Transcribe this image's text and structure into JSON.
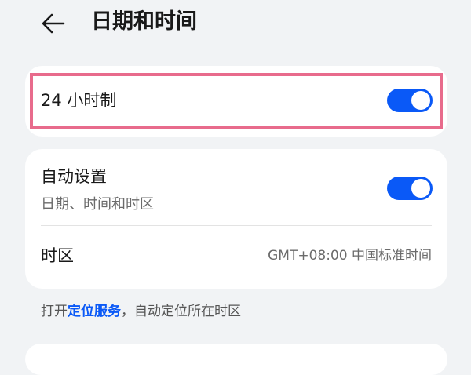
{
  "header": {
    "title": "日期和时间",
    "back_icon": "arrow-left-icon"
  },
  "settings": {
    "hour24": {
      "label": "24 小时制",
      "enabled": true
    },
    "auto_set": {
      "label": "自动设置",
      "subtitle": "日期、时间和时区",
      "enabled": true
    },
    "timezone": {
      "label": "时区",
      "value": "GMT+08:00 中国标准时间"
    }
  },
  "footer": {
    "prefix": "打开",
    "link": "定位服务",
    "suffix": "，自动定位所在时区"
  },
  "colors": {
    "accent": "#0a59f7",
    "highlight": "#e86b8c",
    "background": "#f1f3f5"
  }
}
